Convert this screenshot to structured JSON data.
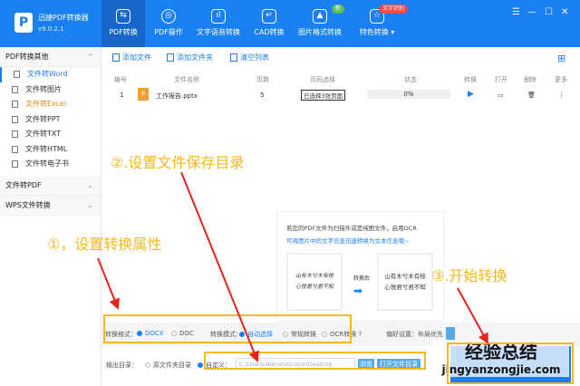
{
  "app": {
    "name": "迅捷PDF转换器",
    "version": "v9.0.2.1"
  },
  "tabs": [
    {
      "label": "PDF转换",
      "icon": "convert-icon"
    },
    {
      "label": "PDF操作",
      "icon": "disc-icon"
    },
    {
      "label": "文字语音转换",
      "icon": "audio-icon"
    },
    {
      "label": "CAD转换",
      "icon": "cad-icon"
    },
    {
      "label": "图片格式转换",
      "icon": "image-icon",
      "badge": "新"
    },
    {
      "label": "特色转换",
      "icon": "star-icon",
      "badge": "文字识别"
    }
  ],
  "sidebar": {
    "group1": "PDF转换其他",
    "items": [
      "文件转Word",
      "文件转图片",
      "文件转Excel",
      "文件转PPT",
      "文件转TXT",
      "文件转HTML",
      "文件转电子书"
    ],
    "group2": "文件转PDF",
    "group3": "WPS文件转换"
  },
  "toolbar": {
    "add_file": "添加文件",
    "add_folder": "添加文件夹",
    "clear": "清空列表"
  },
  "table": {
    "headers": [
      "编号",
      "文件名称",
      "页数",
      "页码选择",
      "状态",
      "转换",
      "打开",
      "删除",
      "更多"
    ],
    "rows": [
      {
        "no": "1",
        "name": "工作报告.pptx",
        "pages": "5",
        "range": "已选择3张页面",
        "status": "0%"
      }
    ]
  },
  "annotations": {
    "a1": "①，设置转换属性",
    "a2": "②.设置文件保存目录",
    "a3": "③.开始转换"
  },
  "tips": {
    "line1": "若您的PDF文件为扫描件或是纯图文件，启用OCR",
    "line2": "可将图片中的文字信息迅速转换为文本信息哦~",
    "after": "转换后",
    "handwriting1": "山有木兮木有枝",
    "handwriting2": "心悦君兮君不知",
    "result1": "山有木兮木有枝",
    "result2": "心悦君兮君不知"
  },
  "settings": {
    "format_label": "转换格式：",
    "docx": "DOCX",
    "doc": "DOC",
    "mode_label": "转换模式：",
    "auto": "自动选择",
    "normal": "常规转换",
    "ocr": "OCR转换",
    "pref_label": "偏好设置：",
    "pref_value": "布局优先"
  },
  "output": {
    "label": "输出目录：",
    "source": "原文件夹目录",
    "custom": "自定义：",
    "path": "C:\\Users\\Administrator\\Desktop",
    "browse": "浏览",
    "open": "打开文件目录"
  },
  "watermark": {
    "cn": "经验总结",
    "url": "jingyanzongjie.com"
  }
}
